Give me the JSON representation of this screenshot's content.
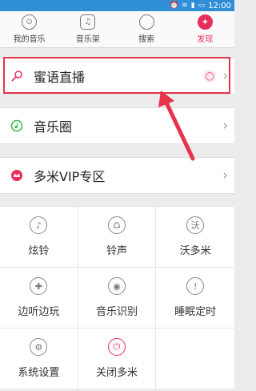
{
  "status": {
    "icons": [
      "alarm-icon",
      "wifi-icon",
      "signal-icon",
      "battery-icon"
    ],
    "time": "12:00"
  },
  "tabs": [
    {
      "label": "我的音乐",
      "icon": "headphones-icon",
      "glyph": "⊙",
      "active": false
    },
    {
      "label": "音乐架",
      "icon": "music-note-icon",
      "glyph": "♫",
      "active": false
    },
    {
      "label": "搜索",
      "icon": "search-icon",
      "glyph": "",
      "active": false
    },
    {
      "label": "发现",
      "icon": "compass-icon",
      "glyph": "✦",
      "active": true
    }
  ],
  "rows": {
    "live": {
      "label": "蜜语直播",
      "icon": "microphone-icon",
      "badge_icon": "user-icon"
    },
    "circle": {
      "label": "音乐圈",
      "icon": "music-circle-icon"
    },
    "vip": {
      "label": "多米VIP专区",
      "icon": "vip-crown-icon"
    }
  },
  "grid": [
    {
      "label": "炫铃",
      "icon": "music-note-icon",
      "glyph": "♪"
    },
    {
      "label": "铃声",
      "icon": "bell-icon",
      "glyph": "🔔"
    },
    {
      "label": "沃多米",
      "icon": "wo-icon",
      "glyph": "沃"
    },
    {
      "label": "边听边玩",
      "icon": "gamepad-icon",
      "glyph": "✚"
    },
    {
      "label": "音乐识别",
      "icon": "recognize-icon",
      "glyph": "◉"
    },
    {
      "label": "睡眠定时",
      "icon": "sleep-timer-icon",
      "glyph": "!"
    },
    {
      "label": "系统设置",
      "icon": "gear-icon",
      "glyph": "⚙"
    },
    {
      "label": "关闭多米",
      "icon": "power-icon",
      "glyph": "⏻",
      "accent": "#e72e5b"
    }
  ],
  "colors": {
    "accent": "#e72e5b",
    "highlight": "#e8334a",
    "statusbar": "#2f8ed6"
  }
}
